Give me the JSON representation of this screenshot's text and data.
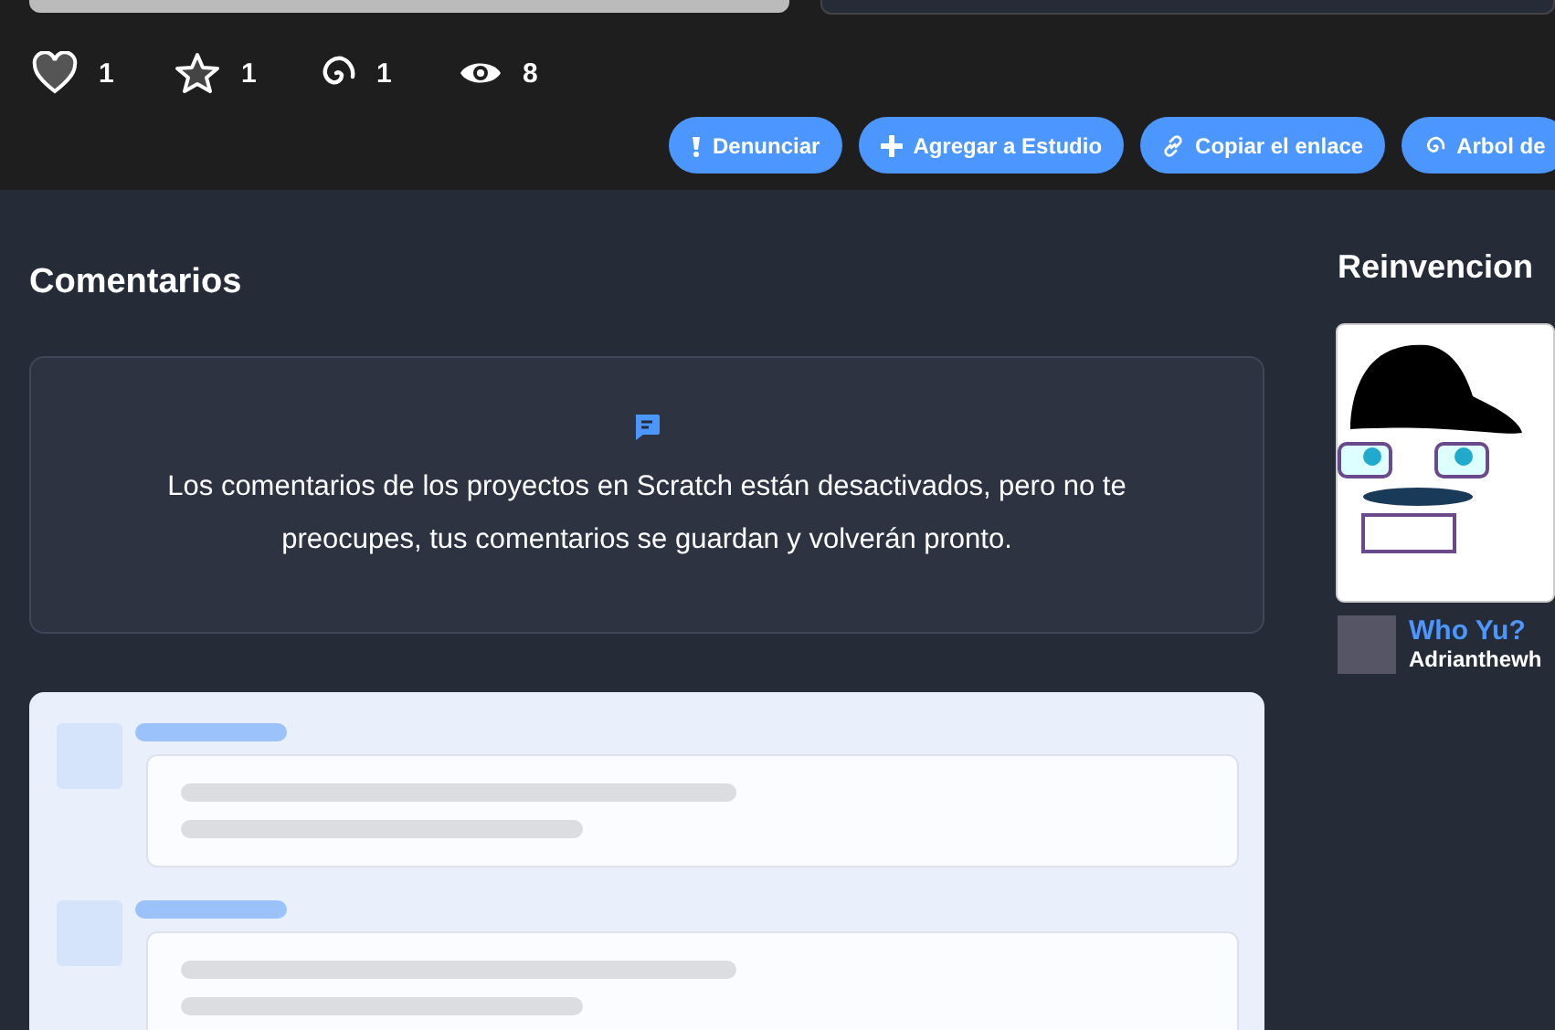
{
  "stats": [
    {
      "kind": "love",
      "count": "1"
    },
    {
      "kind": "favorite",
      "count": "1"
    },
    {
      "kind": "remix",
      "count": "1"
    },
    {
      "kind": "views",
      "count": "8"
    }
  ],
  "actions": [
    {
      "kind": "report",
      "label": "Denunciar"
    },
    {
      "kind": "add",
      "label": "Agregar a Estudio"
    },
    {
      "kind": "link",
      "label": "Copiar el enlace"
    },
    {
      "kind": "remix",
      "label": "Arbol de"
    }
  ],
  "comments": {
    "title": "Comentarios",
    "notice": "Los comentarios de los proyectos en Scratch están desactivados, pero no te preocupes, tus comentarios se guardan y volverán pronto."
  },
  "remixes": {
    "title": "Reinvencion",
    "items": [
      {
        "title": "Who Yu?",
        "author": "Adrianthewh"
      }
    ]
  }
}
